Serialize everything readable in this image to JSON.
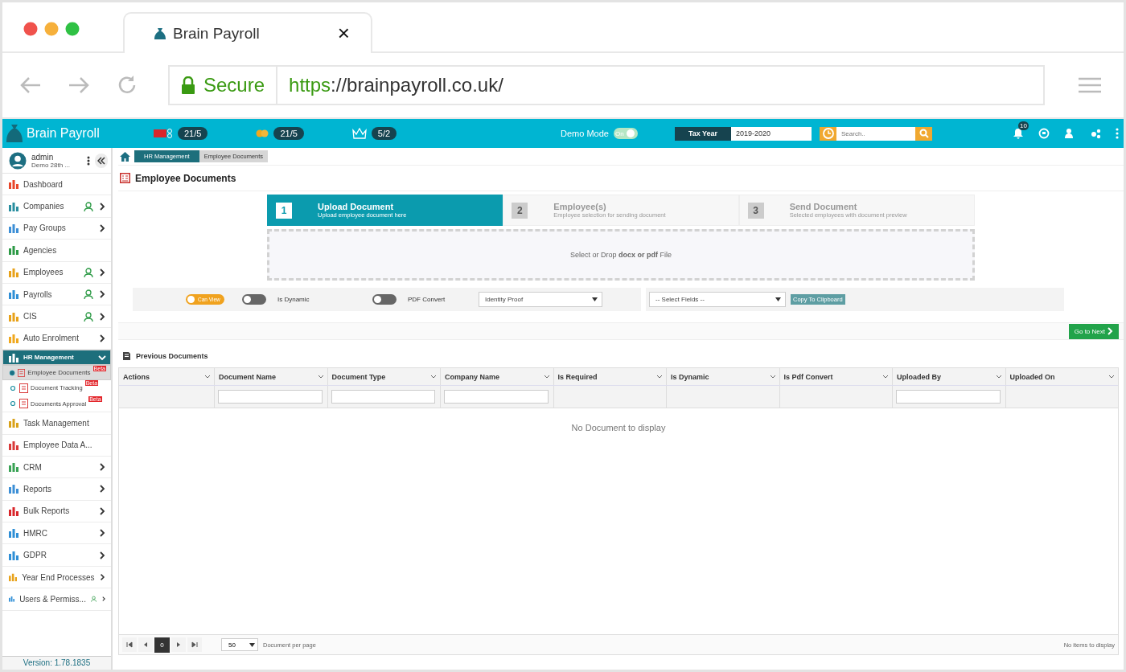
{
  "browser": {
    "tab_title": "Brain Payroll",
    "close": "×",
    "secure_label": "Secure",
    "url_scheme": "https",
    "url_rest": "://brainpayroll.co.uk/"
  },
  "app_bar": {
    "logo": "Brain Payroll",
    "counters": [
      {
        "kind": "tax",
        "value": "21/5"
      },
      {
        "kind": "coins",
        "value": "21/5"
      },
      {
        "kind": "crown",
        "value": "5/2"
      }
    ],
    "demo_mode": {
      "label": "Demo Mode",
      "on": true,
      "switch_label": "On"
    },
    "tax_year": {
      "label": "Tax Year",
      "value": "2019-2020"
    },
    "search": {
      "placeholder": "Search.."
    },
    "notifications": "10"
  },
  "user": {
    "name": "admin",
    "company": "Demo 28th ..."
  },
  "sidebar": {
    "items": [
      {
        "label": "Dashboard",
        "submenu": false,
        "shortcut": false,
        "selected": false
      },
      {
        "label": "Companies",
        "submenu": true,
        "shortcut": true,
        "selected": false
      },
      {
        "label": "Pay Groups",
        "submenu": true,
        "shortcut": false,
        "selected": false
      },
      {
        "label": "Agencies",
        "submenu": false,
        "shortcut": false,
        "selected": false
      },
      {
        "label": "Employees",
        "submenu": true,
        "shortcut": true,
        "selected": false
      },
      {
        "label": "Payrolls",
        "submenu": true,
        "shortcut": true,
        "selected": false
      },
      {
        "label": "CIS",
        "submenu": true,
        "shortcut": true,
        "selected": false
      },
      {
        "label": "Auto Enrolment",
        "submenu": true,
        "shortcut": false,
        "selected": false
      },
      {
        "label": "HR Management",
        "submenu": true,
        "shortcut": false,
        "selected": true,
        "expanded": true,
        "children": [
          {
            "label": "Employee Documents",
            "badge": "Beta",
            "selected": true
          },
          {
            "label": "Document Tracking",
            "badge": "Beta",
            "selected": false
          },
          {
            "label": "Documents Approval",
            "badge": "Beta",
            "selected": false
          }
        ]
      },
      {
        "label": "Task Management",
        "submenu": false,
        "shortcut": false,
        "selected": false
      },
      {
        "label": "Employee Data A...",
        "submenu": false,
        "shortcut": false,
        "selected": false
      },
      {
        "label": "CRM",
        "submenu": true,
        "shortcut": false,
        "selected": false
      },
      {
        "label": "Reports",
        "submenu": true,
        "shortcut": false,
        "selected": false
      },
      {
        "label": "Bulk Reports",
        "submenu": true,
        "shortcut": false,
        "selected": false
      },
      {
        "label": "HMRC",
        "submenu": true,
        "shortcut": false,
        "selected": false
      },
      {
        "label": "GDPR",
        "submenu": true,
        "shortcut": false,
        "selected": false
      },
      {
        "label": "Year End Processes",
        "submenu": true,
        "shortcut": false,
        "selected": false
      },
      {
        "label": "Users & Permiss...",
        "submenu": true,
        "shortcut": true,
        "selected": false
      }
    ],
    "version": "Version: 1.78.1835"
  },
  "breadcrumb": [
    "HR Management",
    "Employee Documents"
  ],
  "page_title": "Employee Documents",
  "steps": [
    {
      "number": "1",
      "title": "Upload Document",
      "subtitle": "Upload employee document here",
      "selected": true
    },
    {
      "number": "2",
      "title": "Employee(s)",
      "subtitle": "Employee selection for sending document",
      "selected": false
    },
    {
      "number": "3",
      "title": "Send Document",
      "subtitle": "Selected employees with document preview",
      "selected": false
    }
  ],
  "dropzone": "Select or Drop **docx or pdf** File",
  "options": {
    "toggles": [
      {
        "kind": "pill",
        "label": "Can View",
        "on": true
      },
      {
        "kind": "switch",
        "label": "Is Dynamic",
        "on": false
      },
      {
        "kind": "switch",
        "label": "PDF Convert",
        "on": false
      }
    ],
    "document_type": "Identity Proof",
    "fields": "-- Select Fields --",
    "copy_button": "Copy To Clipboard"
  },
  "next_button": "Go to Next",
  "previous_documents": {
    "title": "Previous Documents",
    "columns": [
      {
        "label": "Actions",
        "filter": false
      },
      {
        "label": "Document Name",
        "filter": true
      },
      {
        "label": "Document Type",
        "filter": true
      },
      {
        "label": "Company Name",
        "filter": true
      },
      {
        "label": "Is Required",
        "filter": false
      },
      {
        "label": "Is Dynamic",
        "filter": false
      },
      {
        "label": "Is Pdf Convert",
        "filter": false
      },
      {
        "label": "Uploaded By",
        "filter": true
      },
      {
        "label": "Uploaded On",
        "filter": false
      }
    ],
    "empty": "No Document to display",
    "pager": {
      "page": "0",
      "per_page": "50",
      "per_page_label": "Document per page",
      "status": "No items to display"
    }
  }
}
